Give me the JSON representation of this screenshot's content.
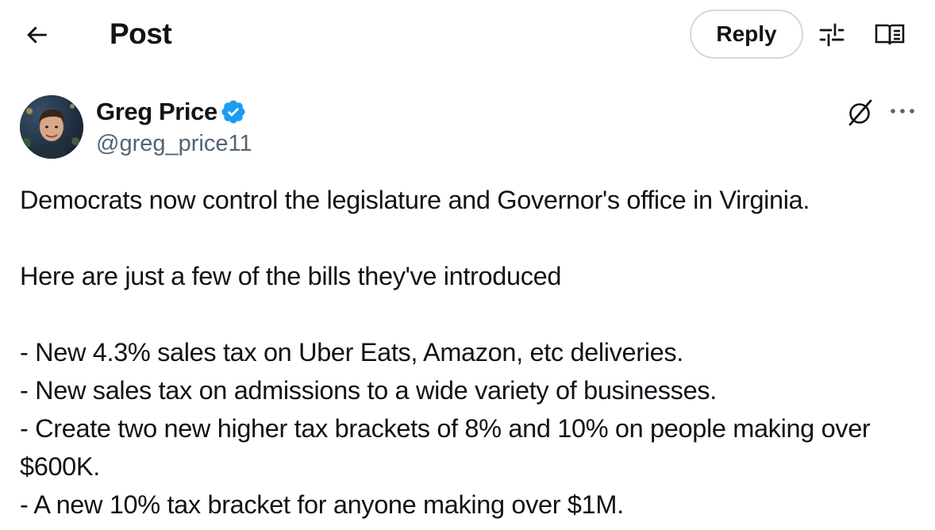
{
  "header": {
    "title": "Post",
    "reply_label": "Reply",
    "icons": [
      "back-arrow-icon",
      "tune-icon",
      "reader-mode-icon"
    ]
  },
  "author": {
    "name": "Greg Price",
    "handle": "@greg_price11",
    "verified": true,
    "verified_color": "#1d9bf0"
  },
  "post": {
    "paragraphs": [
      "Democrats now control the legislature and Governor's office in Virginia.",
      "Here are just a few of the bills they've introduced",
      "- New 4.3% sales tax on Uber Eats, Amazon, etc deliveries.",
      "- New sales tax on admissions to a wide variety of businesses.",
      "- Create two new higher tax brackets of 8% and 10% on people making over $600K.",
      "- A new 10% tax bracket for anyone making over $1M."
    ]
  },
  "colors": {
    "text": "#0f1419",
    "secondary_text": "#536471",
    "border": "#cfd9de",
    "accent": "#1d9bf0"
  }
}
